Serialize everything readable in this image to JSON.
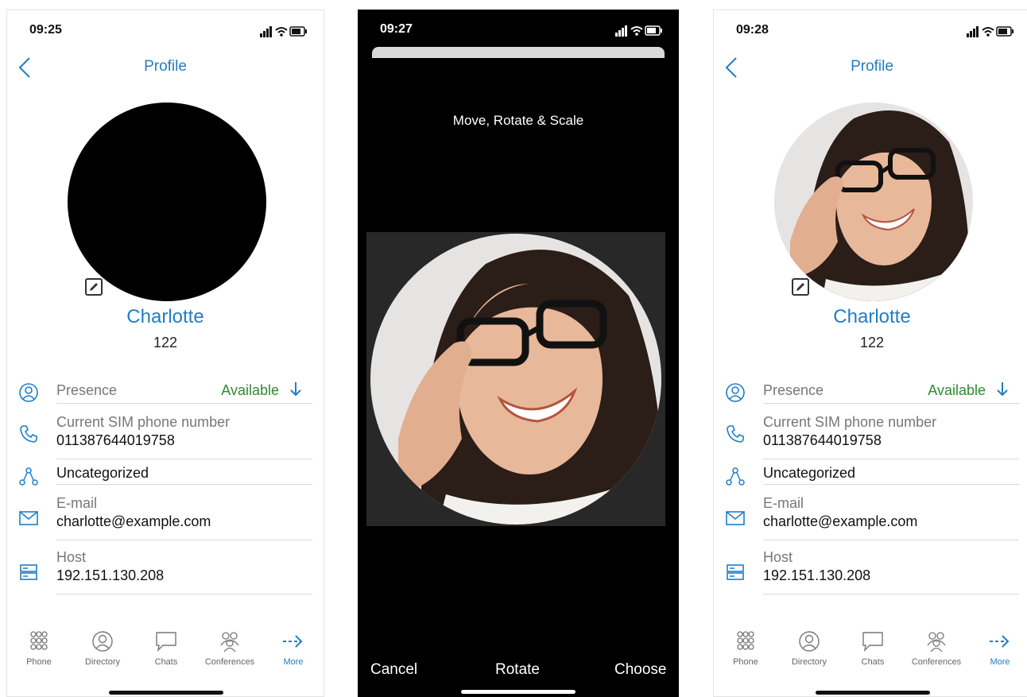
{
  "screens": [
    {
      "status_time": "09:25",
      "nav_title": "Profile",
      "avatar_state": "empty",
      "name": "Charlotte",
      "extension": "122",
      "fields": {
        "presence_label": "Presence",
        "presence_value": "Available",
        "sim_label": "Current SIM phone number",
        "sim_value": "011387644019758",
        "category_value": "Uncategorized",
        "email_label": "E-mail",
        "email_value": "charlotte@example.com",
        "host_label": "Host",
        "host_value": "192.151.130.208"
      },
      "tabs": [
        "Phone",
        "Directory",
        "Chats",
        "Conferences",
        "More"
      ],
      "active_tab": "More"
    },
    {
      "status_time": "09:27",
      "hint": "Move, Rotate & Scale",
      "buttons": {
        "cancel": "Cancel",
        "rotate": "Rotate",
        "choose": "Choose"
      }
    },
    {
      "status_time": "09:28",
      "nav_title": "Profile",
      "avatar_state": "photo",
      "name": "Charlotte",
      "extension": "122",
      "fields": {
        "presence_label": "Presence",
        "presence_value": "Available",
        "sim_label": "Current SIM phone number",
        "sim_value": "011387644019758",
        "category_value": "Uncategorized",
        "email_label": "E-mail",
        "email_value": "charlotte@example.com",
        "host_label": "Host",
        "host_value": "192.151.130.208"
      },
      "tabs": [
        "Phone",
        "Directory",
        "Chats",
        "Conferences",
        "More"
      ],
      "active_tab": "More"
    }
  ],
  "colors": {
    "accent": "#1f7ec7",
    "available": "#2e8b2e"
  },
  "icons": [
    "back-chevron-icon",
    "edit-pencil-icon",
    "presence-person-icon",
    "phone-icon",
    "category-nodes-icon",
    "envelope-icon",
    "server-icon",
    "down-arrow-icon",
    "dialpad-icon",
    "directory-icon",
    "chat-bubble-icon",
    "conferences-icon",
    "more-arrow-icon"
  ]
}
